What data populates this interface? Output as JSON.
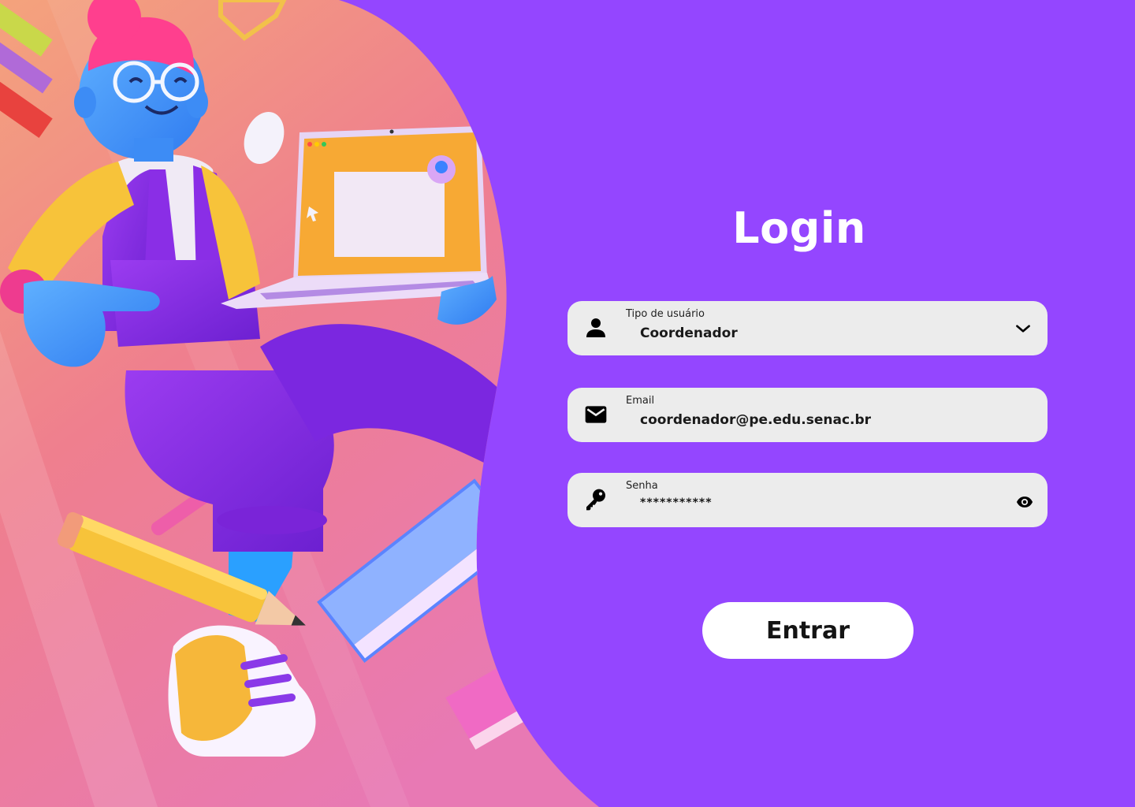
{
  "login": {
    "title": "Login",
    "fields": {
      "user_type": {
        "label": "Tipo de usuário",
        "value": "Coordenador"
      },
      "email": {
        "label": "Email",
        "value": "coordenador@pe.edu.senac.br"
      },
      "password": {
        "label": "Senha",
        "value": "***********"
      }
    },
    "submit_label": "Entrar"
  },
  "icons": {
    "user_type": "person-icon",
    "user_type_toggle": "chevron-down-icon",
    "email": "mail-icon",
    "password": "key-icon",
    "password_toggle": "eye-icon"
  },
  "colors": {
    "accent": "#9446ff",
    "field_bg": "#ececec",
    "button_bg": "#ffffff"
  }
}
